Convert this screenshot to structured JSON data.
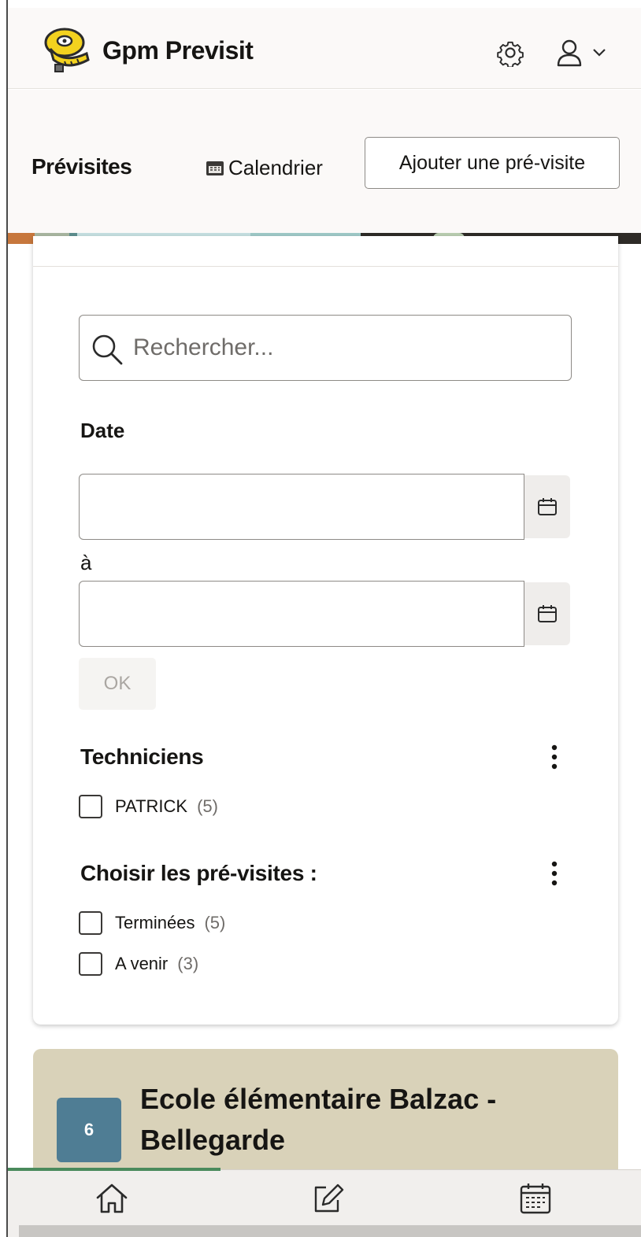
{
  "header": {
    "app_title": "Gpm Previsit",
    "logo_icon": "measuring-tape-icon",
    "settings_icon": "gear-icon",
    "user_icon": "user-icon",
    "menu_icon": "chevron-down-icon"
  },
  "toolbar": {
    "title": "Prévisites",
    "calendar_label": "Calendrier",
    "add_button_label": "Ajouter une pré-visite"
  },
  "filters": {
    "search_placeholder": "Rechercher...",
    "date_label": "Date",
    "date_from_value": "",
    "date_to_value": "",
    "date_range_separator": "à",
    "ok_label": "OK",
    "technicians": {
      "title": "Techniciens",
      "options": [
        {
          "label": "PATRICK",
          "count": "(5)"
        }
      ]
    },
    "status": {
      "title": "Choisir les pré-visites :",
      "options": [
        {
          "label": "Terminées",
          "count": "(5)"
        },
        {
          "label": "A venir",
          "count": "(3)"
        }
      ]
    }
  },
  "results": [
    {
      "badge": "6",
      "title": "Ecole élémentaire Balzac - Bellegarde"
    }
  ],
  "bottom_nav": {
    "items": [
      "home-icon",
      "edit-icon",
      "calendar-icon"
    ]
  },
  "colors": {
    "badge": "#4f7d94",
    "result_card": "#d9d2b9",
    "nav_indicator": "#4a8a5c"
  }
}
